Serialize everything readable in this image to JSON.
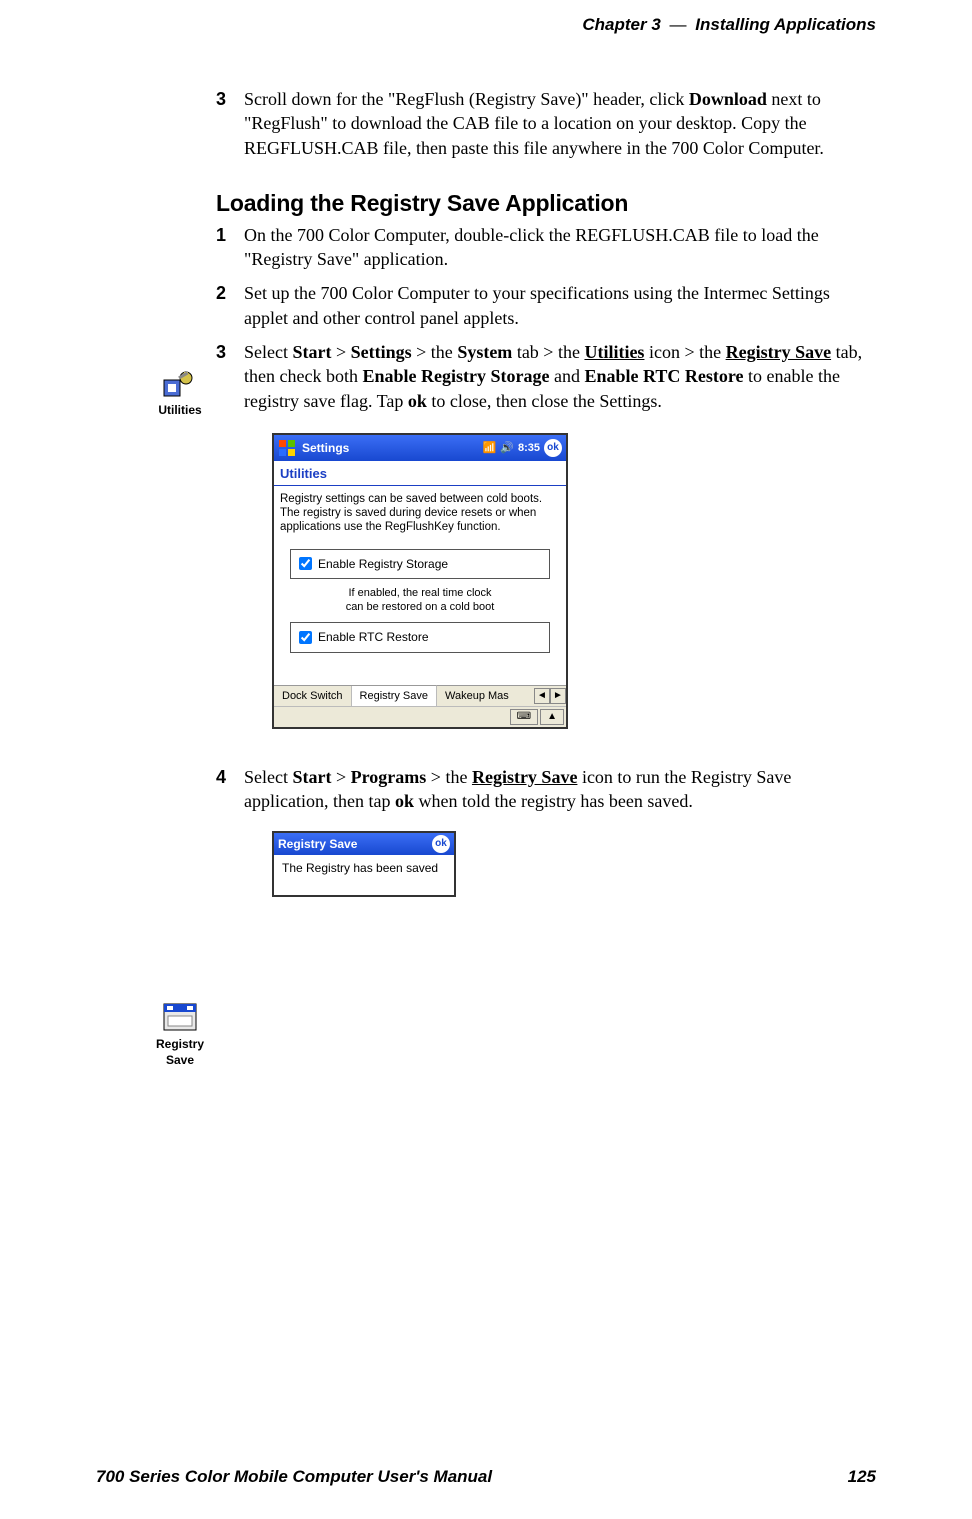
{
  "header": {
    "chapter": "Chapter  3",
    "dash": "—",
    "title": "Installing Applications"
  },
  "step3_top": {
    "num": "3",
    "text_parts": [
      "Scroll down for the \"RegFlush (Registry Save)\" header, click ",
      "Download",
      " next to \"RegFlush\" to download the CAB file to a location on your desktop. Copy the REGFLUSH.CAB file, then paste this file anywhere in the 700 Color Computer."
    ]
  },
  "section_heading": "Loading the Registry Save Application",
  "loading_steps": {
    "s1": {
      "num": "1",
      "text": "On the 700 Color Computer, double-click the REGFLUSH.CAB file to load the \"Registry Save\" application."
    },
    "s2": {
      "num": "2",
      "text": "Set up the 700 Color Computer to your specifications using the Intermec Settings applet and other control panel applets."
    },
    "s3": {
      "num": "3",
      "parts": [
        "Select ",
        "Start",
        " > ",
        "Settings",
        " > the ",
        "System",
        " tab > the ",
        "Utilities",
        " icon > the ",
        "Registry Save",
        " tab, then check both ",
        "Enable Registry Storage",
        " and ",
        "Enable RTC Restore",
        " to enable the registry save flag. Tap ",
        "ok",
        " to close, then close the Settings."
      ]
    },
    "s4": {
      "num": "4",
      "parts": [
        "Select ",
        "Start",
        " > ",
        "Programs",
        " > the ",
        "Registry Save",
        " icon to run the Registry Save application, then tap ",
        "ok",
        " when told the registry has been saved."
      ]
    }
  },
  "margin_icons": {
    "utilities_label": "Utilities",
    "regsave_label": "Registry\nSave"
  },
  "settings_window": {
    "title": "Settings",
    "time": "8:35",
    "ok": "ok",
    "subheader": "Utilities",
    "desc": "Registry settings can be saved between cold boots. The registry is saved during device resets or when applications use the RegFlushKey function.",
    "opt1": "Enable Registry Storage",
    "hint": "If enabled, the real time clock\ncan be restored on a cold boot",
    "opt2": "Enable RTC Restore",
    "tabs": [
      "Dock Switch",
      "Registry Save",
      "Wakeup Mas"
    ],
    "arrows": [
      "◄",
      "►"
    ],
    "kbd": "⌨",
    "up": "▲"
  },
  "dialog": {
    "title": "Registry Save",
    "ok": "ok",
    "body": "The Registry has been saved"
  },
  "footer": {
    "left": "700 Series Color Mobile Computer User's Manual",
    "right": "125"
  }
}
